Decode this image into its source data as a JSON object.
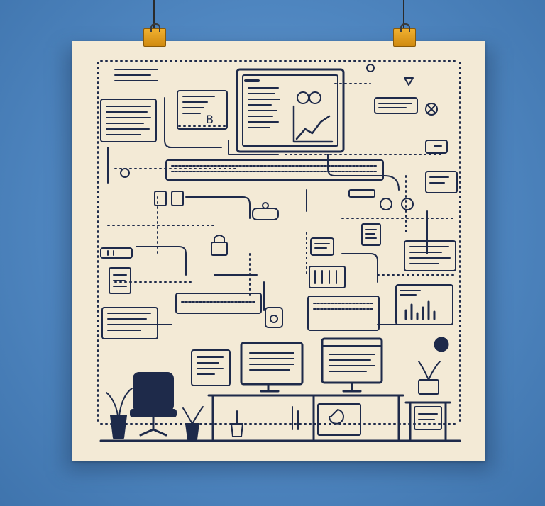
{
  "scene": {
    "background_color": "#4f86c0",
    "poster_color": "#f3ead6",
    "ink_color": "#1e2a4a",
    "clip_color": "#e3a020"
  }
}
